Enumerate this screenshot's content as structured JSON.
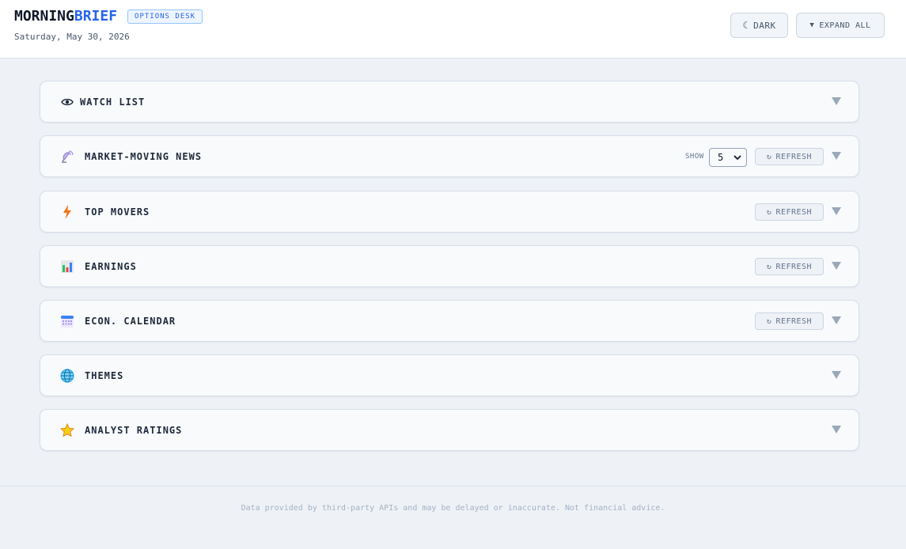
{
  "header": {
    "brand_part1": "MORNING",
    "brand_part2": "BRIEF",
    "badge": "OPTIONS DESK",
    "date": "Saturday, May 30, 2026",
    "dark_button": {
      "icon": "moon-icon",
      "label": "DARK"
    },
    "expand_button": {
      "icon": "triangle-down-icon",
      "label": "EXPAND ALL"
    }
  },
  "sections": [
    {
      "title": "WATCH LIST",
      "icon": "eye-icon"
    },
    {
      "title": "MARKET-MOVING NEWS",
      "icon": "satellite-dish-icon",
      "show_label": "SHOW",
      "show_value": "5",
      "refresh_label": "REFRESH"
    },
    {
      "title": "TOP MOVERS",
      "icon": "lightning-icon",
      "refresh_label": "REFRESH"
    },
    {
      "title": "EARNINGS",
      "icon": "bar-chart-icon",
      "refresh_label": "REFRESH"
    },
    {
      "title": "ECON. CALENDAR",
      "icon": "calendar-icon",
      "refresh_label": "REFRESH"
    },
    {
      "title": "THEMES",
      "icon": "globe-icon"
    },
    {
      "title": "ANALYST RATINGS",
      "icon": "star-icon"
    }
  ],
  "footer": {
    "disclaimer": "Data provided by third-party APIs and may be delayed or inaccurate. Not financial advice."
  },
  "colors": {
    "accent": "#2563eb",
    "background": "#eef2f7",
    "panel": "#f8fafc"
  }
}
